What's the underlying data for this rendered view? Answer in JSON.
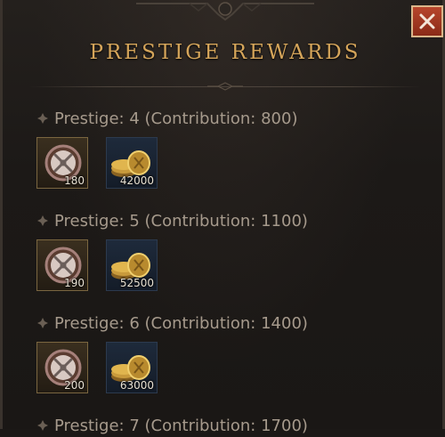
{
  "window": {
    "title": "PRESTIGE REWARDS",
    "close_icon": "close-icon"
  },
  "tiers": [
    {
      "label": "Prestige: 4 (Contribution: 800)",
      "rewards": [
        {
          "icon": "medal-icon",
          "quantity": "180"
        },
        {
          "icon": "gold-coins-icon",
          "quantity": "42000"
        }
      ]
    },
    {
      "label": "Prestige: 5 (Contribution: 1100)",
      "rewards": [
        {
          "icon": "medal-icon",
          "quantity": "190"
        },
        {
          "icon": "gold-coins-icon",
          "quantity": "52500"
        }
      ]
    },
    {
      "label": "Prestige: 6 (Contribution: 1400)",
      "rewards": [
        {
          "icon": "medal-icon",
          "quantity": "200"
        },
        {
          "icon": "gold-coins-icon",
          "quantity": "63000"
        }
      ]
    },
    {
      "label": "Prestige: 7 (Contribution: 1700)"
    }
  ],
  "colors": {
    "title": "#d5a55a",
    "header_text": "#a69a8c",
    "close_button": "#b7462c"
  }
}
